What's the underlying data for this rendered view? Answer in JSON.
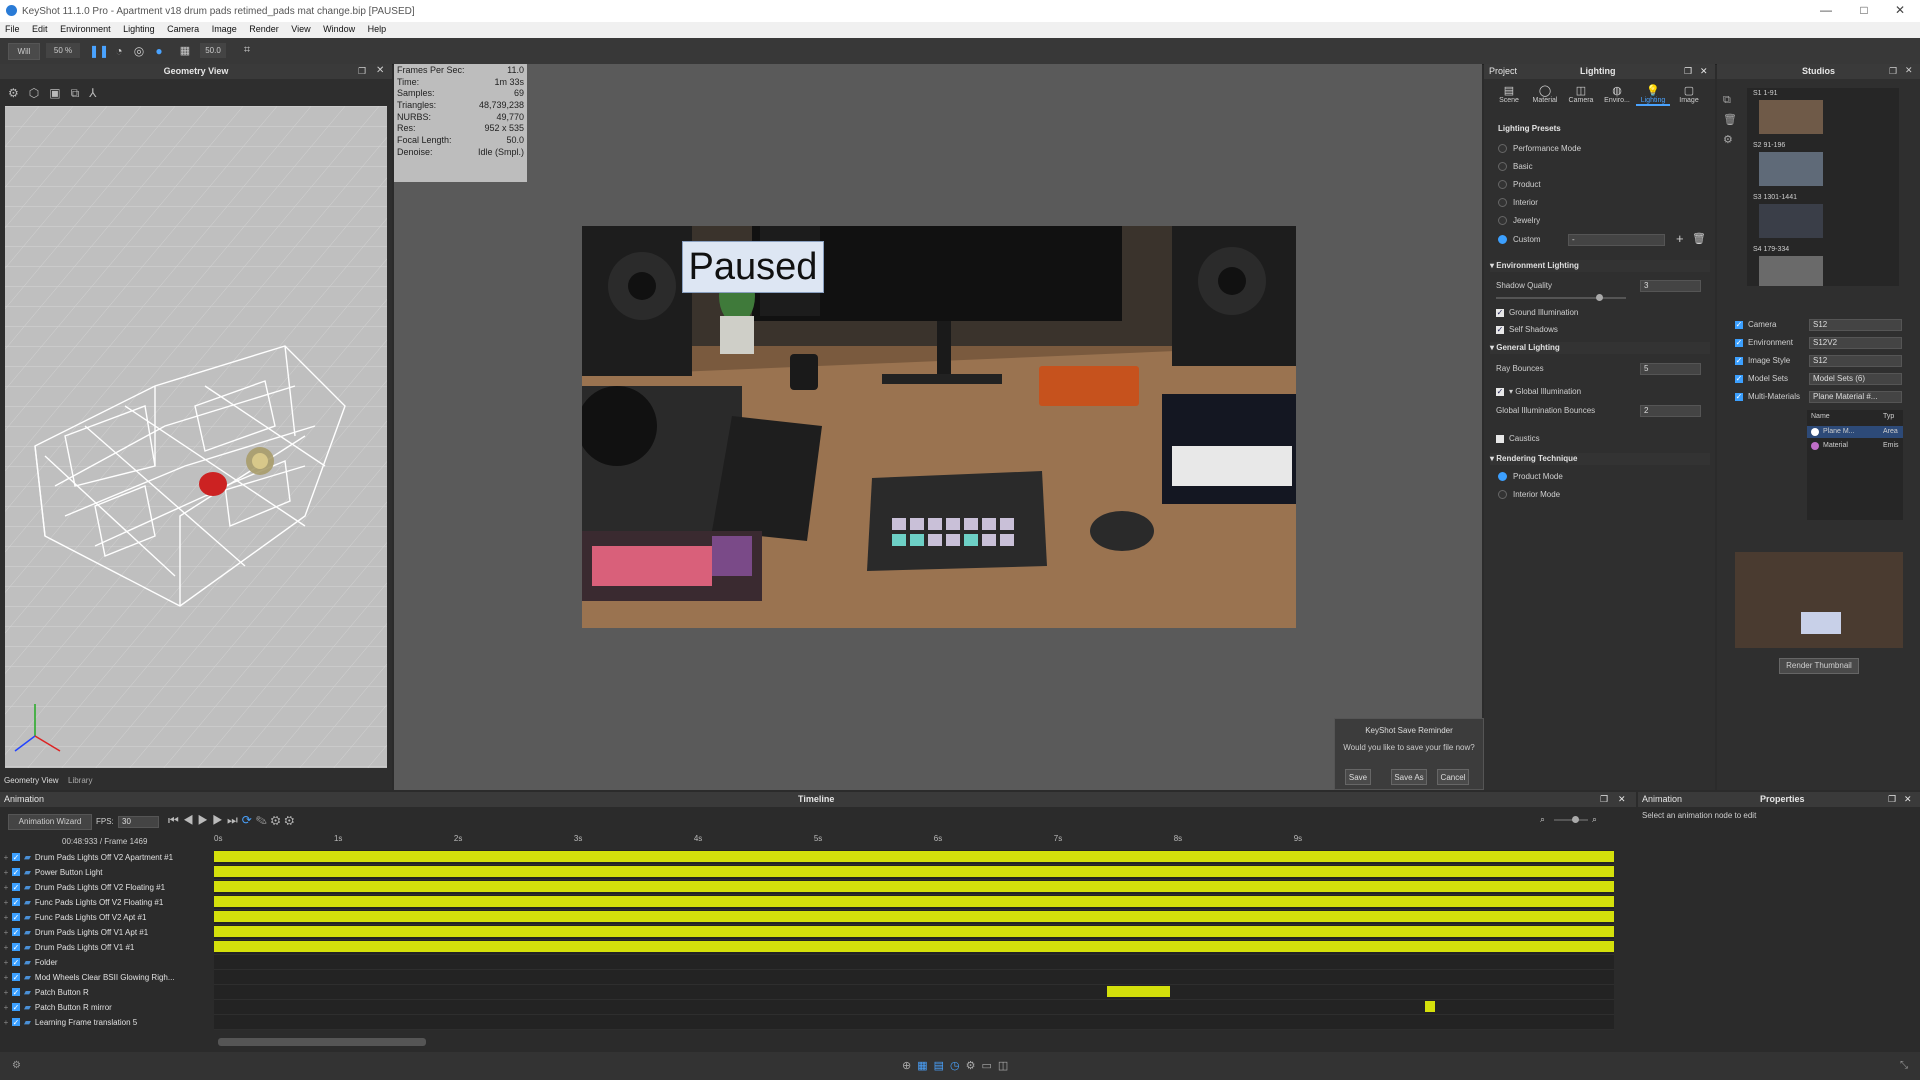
{
  "window": {
    "title": "KeyShot 11.1.0 Pro - Apartment v18 drum pads retimed_pads mat change.bip [PAUSED]",
    "controls": [
      "—",
      "□",
      "✕"
    ]
  },
  "menu": [
    "File",
    "Edit",
    "Environment",
    "Lighting",
    "Camera",
    "Image",
    "Render",
    "View",
    "Window",
    "Help"
  ],
  "toolbar": {
    "mode": "Will",
    "zoom": "50 %",
    "focal": "50.0"
  },
  "geometry_view": {
    "title": "Geometry View",
    "tabs": [
      "Geometry View",
      "Library"
    ]
  },
  "stats": [
    {
      "label": "Frames Per Sec:",
      "value": "11.0"
    },
    {
      "label": "Time:",
      "value": "1m 33s"
    },
    {
      "label": "Samples:",
      "value": "69"
    },
    {
      "label": "Triangles:",
      "value": "48,739,238"
    },
    {
      "label": "NURBS:",
      "value": "49,770"
    },
    {
      "label": "Res:",
      "value": "952 x 535"
    },
    {
      "label": "Focal Length:",
      "value": "50.0"
    },
    {
      "label": "Denoise:",
      "value": "Idle (Smpl.)"
    }
  ],
  "viewport": {
    "paused_label": "Paused"
  },
  "save_reminder": {
    "title": "KeyShot Save Reminder",
    "message": "Would you like to save your file now?",
    "buttons": [
      "Save",
      "Save As",
      "Cancel"
    ]
  },
  "project_panel": {
    "left_label": "Project",
    "title": "Lighting",
    "tabs": [
      "Scene",
      "Material",
      "Camera",
      "Enviro...",
      "Lighting",
      "Image"
    ],
    "presets_title": "Lighting Presets",
    "presets": [
      "Performance Mode",
      "Basic",
      "Product",
      "Interior",
      "Jewelry",
      "Custom"
    ],
    "custom_value": "-",
    "env_lighting_title": "Environment Lighting",
    "shadow_quality_label": "Shadow Quality",
    "shadow_quality_value": "3",
    "ground_illum": "Ground Illumination",
    "self_shadows": "Self Shadows",
    "general_title": "General Lighting",
    "ray_bounces_label": "Ray Bounces",
    "ray_bounces_value": "5",
    "global_illum": "Global Illumination",
    "gi_bounces_label": "Global Illumination Bounces",
    "gi_bounces_value": "2",
    "caustics": "Caustics",
    "render_tech_title": "Rendering Technique",
    "product_mode": "Product Mode",
    "interior_mode": "Interior Mode"
  },
  "studios": {
    "title": "Studios",
    "items": [
      "S1 1-91",
      "S2 91-196",
      "S3 1301-1441",
      "S4 179-334"
    ],
    "props": [
      {
        "label": "Camera",
        "value": "S12"
      },
      {
        "label": "Environment",
        "value": "S12V2"
      },
      {
        "label": "Image Style",
        "value": "S12"
      },
      {
        "label": "Model Sets",
        "value": "Model Sets (6)"
      },
      {
        "label": "Multi-Materials",
        "value": "Plane Material #..."
      }
    ],
    "table_headers": [
      "Name",
      "Typ"
    ],
    "table_rows": [
      {
        "name": "Plane M...",
        "type": "Area"
      },
      {
        "name": "Material",
        "type": "Emis"
      }
    ],
    "render_thumbnail": "Render Thumbnail"
  },
  "animation": {
    "panel_label": "Animation",
    "timeline_title": "Timeline",
    "wizard": "Animation Wizard",
    "fps_label": "FPS:",
    "fps_value": "30",
    "time_readout": "00:48:933 / Frame 1469",
    "ruler": [
      "0s",
      "1s",
      "2s",
      "3s",
      "4s",
      "5s",
      "6s",
      "7s",
      "8s",
      "9s"
    ],
    "tracks": [
      {
        "name": "Drum Pads Lights Off V2 Apartment #1",
        "start": 0.0,
        "end": 1.0
      },
      {
        "name": "Power Button Light",
        "start": 0.0,
        "end": 1.0
      },
      {
        "name": "Drum Pads Lights Off V2 Floating #1",
        "start": 0.0,
        "end": 1.0
      },
      {
        "name": "Func Pads Lights Off V2 Floating #1",
        "start": 0.0,
        "end": 1.0
      },
      {
        "name": "Func Pads Lights Off V2 Apt #1",
        "start": 0.0,
        "end": 1.0
      },
      {
        "name": "Drum Pads Lights Off V1 Apt #1",
        "start": 0.0,
        "end": 1.0
      },
      {
        "name": "Drum Pads Lights Off V1 #1",
        "start": 0.0,
        "end": 1.0
      },
      {
        "name": "Folder",
        "start": null,
        "end": null
      },
      {
        "name": "Mod Wheels Clear BSII Glowing Righ...",
        "start": null,
        "end": null
      },
      {
        "name": "Patch Button R",
        "start": 0.638,
        "end": 0.683
      },
      {
        "name": "Patch Button R mirror",
        "start": 0.865,
        "end": 0.872
      },
      {
        "name": "Learning Frame translation 5",
        "start": null,
        "end": null
      }
    ]
  },
  "properties": {
    "left_label": "Animation",
    "title": "Properties",
    "hint": "Select an animation node to edit"
  },
  "colors": {
    "accent": "#3ca0ff",
    "track_bar": "#d4e00b",
    "panel": "#2f2f2f"
  }
}
